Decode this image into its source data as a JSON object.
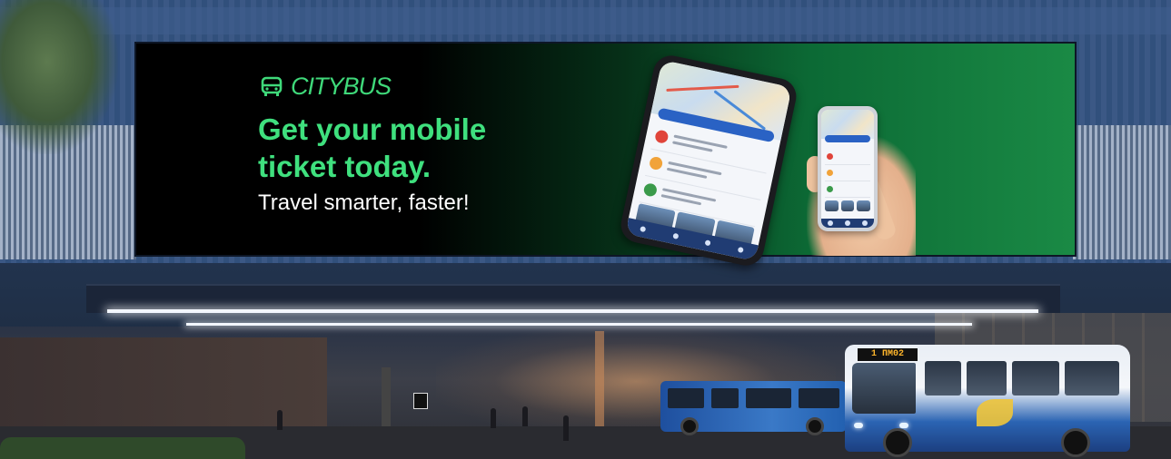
{
  "billboard": {
    "brand": "CITYBUS",
    "headline": "Get your mobile ticket today.",
    "tagline": "Travel smarter, faster!"
  },
  "bus": {
    "destination_sign": "1 ПМ02"
  },
  "colors": {
    "brand_green": "#3fe07e",
    "billboard_green": "#1a8a45",
    "bus_blue": "#2b64b3"
  },
  "icons": {
    "brand": "bus-icon"
  }
}
